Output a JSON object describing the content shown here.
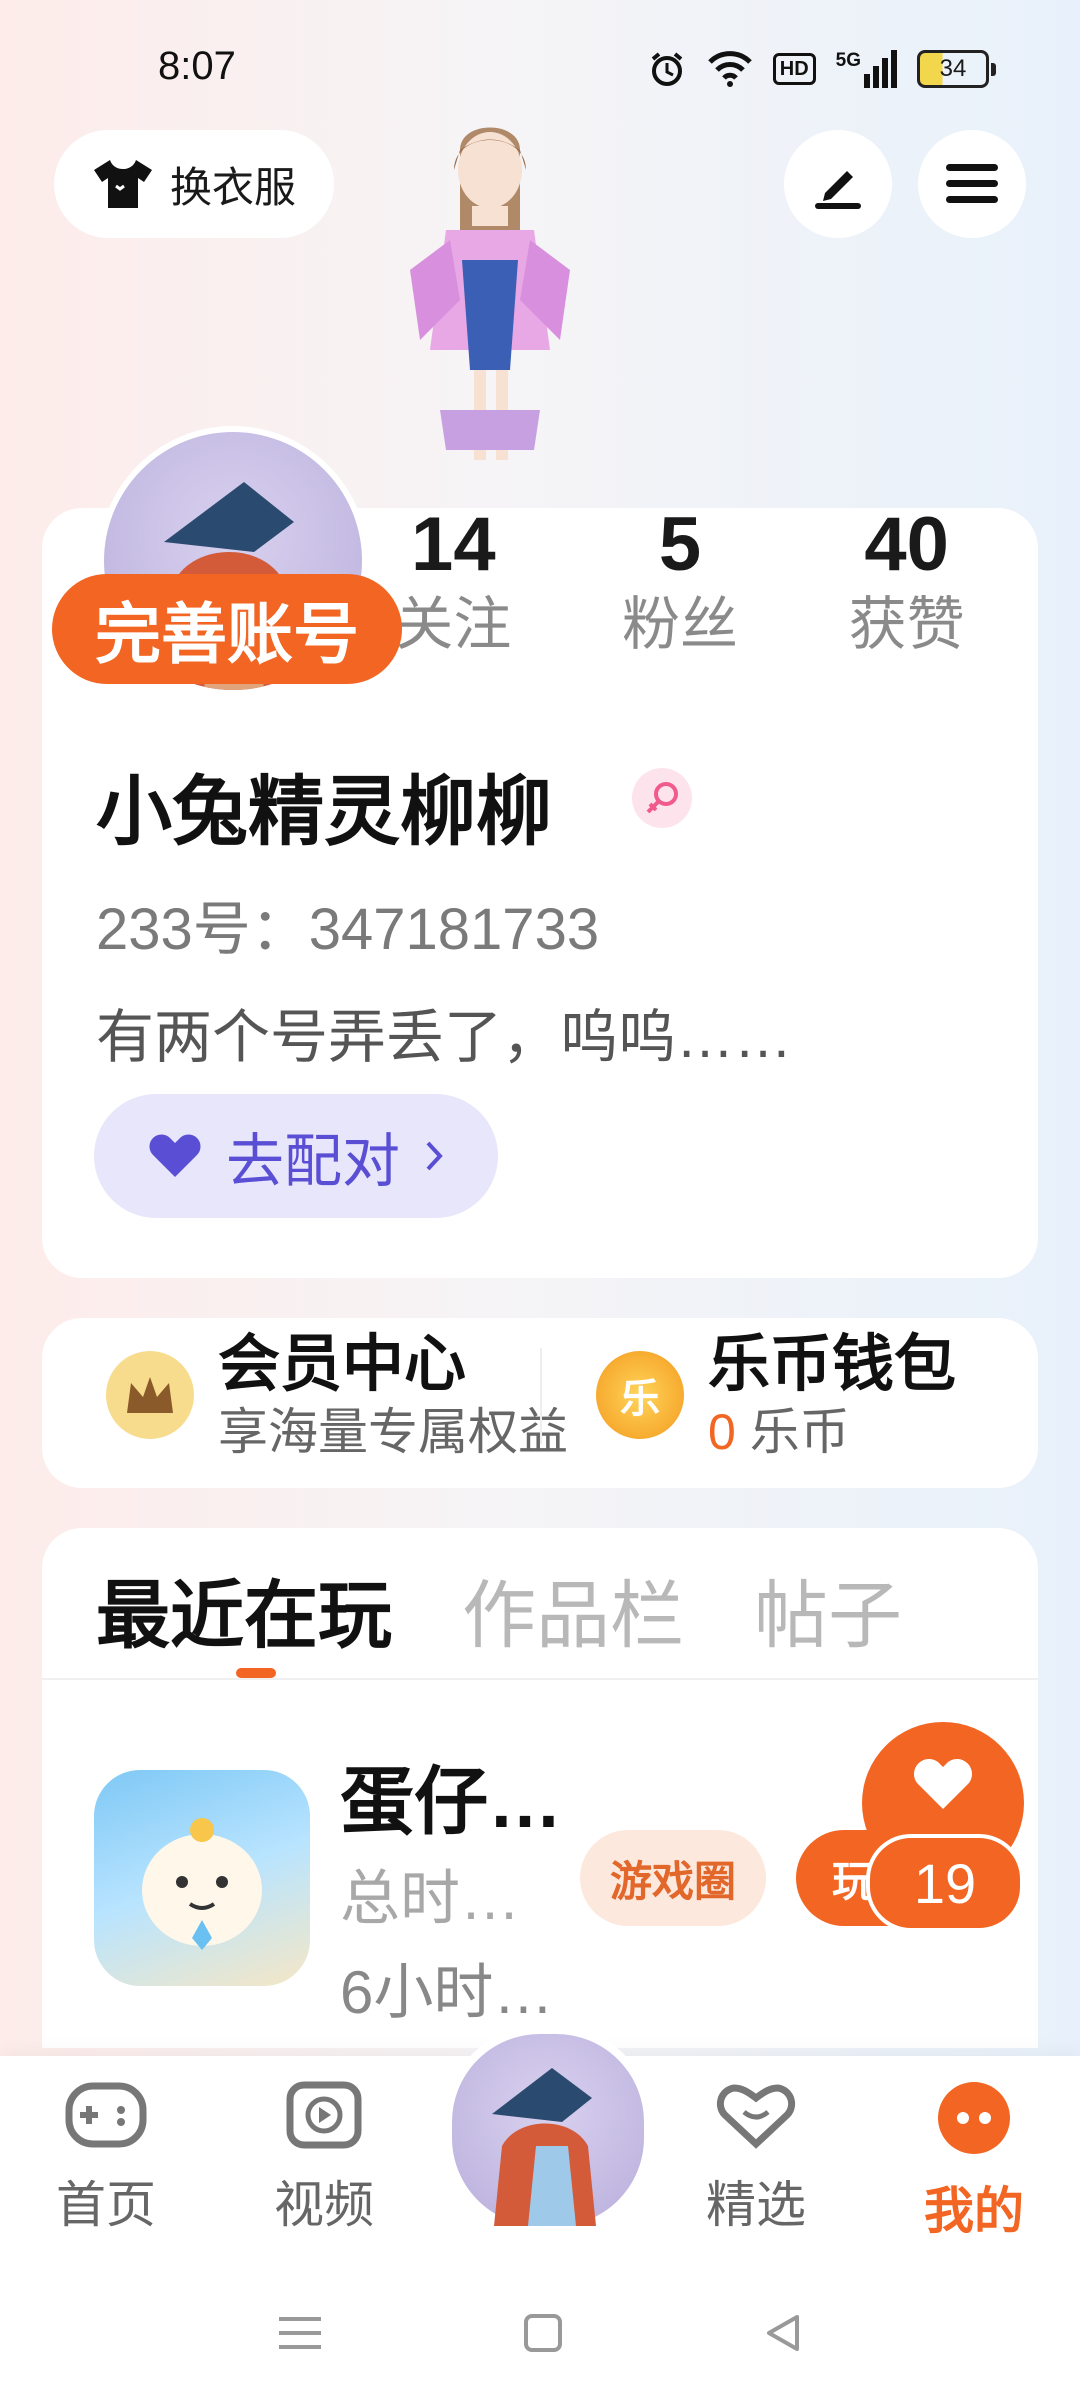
{
  "status_bar": {
    "time": "8:07",
    "signal": "5G",
    "hd": "HD",
    "battery": "34"
  },
  "header": {
    "dress_label": "换衣服"
  },
  "profile": {
    "stats": [
      {
        "value": "14",
        "label": "关注"
      },
      {
        "value": "5",
        "label": "粉丝"
      },
      {
        "value": "40",
        "label": "获赞"
      }
    ],
    "complete_badge": "完善账号",
    "username": "小兔精灵柳柳",
    "uid": "233号：347181733",
    "bio": "有两个号弄丢了，呜呜……",
    "match_label": "去配对"
  },
  "member": {
    "title": "会员中心",
    "subtitle": "享海量专属权益",
    "crown_color": "#8a5a2b"
  },
  "wallet": {
    "title": "乐币钱包",
    "coin_glyph": "乐",
    "amount": "0",
    "unit": "乐币"
  },
  "tabs": [
    {
      "label": "最近在玩",
      "active": true
    },
    {
      "label": "作品栏",
      "active": false
    },
    {
      "label": "帖子",
      "active": false
    }
  ],
  "recent_game": {
    "name": "蛋仔…",
    "time_label": "总时…",
    "time_value": "6小时…",
    "circle_label": "游戏圈",
    "play_label": "玩",
    "like_count": "19"
  },
  "bottom_nav": [
    {
      "label": "首页",
      "icon": "gamepad-icon",
      "active": false
    },
    {
      "label": "视频",
      "icon": "play-icon",
      "active": false
    },
    {
      "label": "精选",
      "icon": "heart-chat-icon",
      "active": false
    },
    {
      "label": "我的",
      "icon": "profile-dots-icon",
      "active": true
    }
  ],
  "colors": {
    "accent": "#f26522",
    "match": "#5a4fd4"
  }
}
